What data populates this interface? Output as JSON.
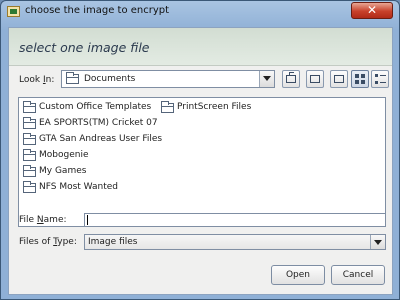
{
  "window": {
    "title": "choose the image to encrypt",
    "close_label": "✕"
  },
  "header": {
    "title": "select one image file"
  },
  "look_in": {
    "label_prefix": "Look ",
    "label_underlined": "I",
    "label_suffix": "n:",
    "value": "Documents"
  },
  "toolbar": {
    "buttons": [
      {
        "icon": "up-folder-icon",
        "active": false
      },
      {
        "icon": "home-icon",
        "active": false
      },
      {
        "icon": "new-folder-icon",
        "active": false
      },
      {
        "icon": "list-view-icon",
        "active": true
      },
      {
        "icon": "details-view-icon",
        "active": false
      }
    ]
  },
  "files": [
    "Custom Office Templates",
    "PrintScreen Files",
    "EA SPORTS(TM) Cricket 07",
    "GTA San Andreas User Files",
    "Mobogenie",
    "My Games",
    "NFS Most Wanted"
  ],
  "file_name": {
    "label_prefix": "File ",
    "label_underlined": "N",
    "label_suffix": "ame:",
    "value": ""
  },
  "file_type": {
    "label_prefix": "Files of ",
    "label_underlined": "T",
    "label_suffix": "ype:",
    "value": "Image files"
  },
  "buttons": {
    "open": "Open",
    "cancel": "Cancel"
  }
}
